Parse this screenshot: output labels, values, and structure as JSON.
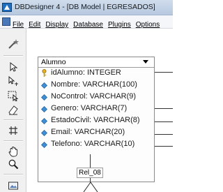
{
  "window": {
    "title": "DBDesigner 4 - [DB Model | EGRESADOS]",
    "titlebar_color": "#b7c9e0"
  },
  "menu": {
    "items": [
      "File",
      "Edit",
      "Display",
      "Database",
      "Plugins",
      "Options"
    ]
  },
  "toolbar": {
    "tools": [
      "magic-wand-icon",
      "pointer-icon",
      "move-pointer-icon",
      "select-area-icon",
      "eraser-icon",
      "grid-icon",
      "hand-icon",
      "zoom-icon",
      "image-icon"
    ]
  },
  "table": {
    "name": "Alumno",
    "columns": [
      {
        "label": "idAlumno: INTEGER",
        "icon": "key-icon"
      },
      {
        "label": "Nombre: VARCHAR(100)",
        "icon": "field-icon"
      },
      {
        "label": "NoControl: VARCHAR(9)",
        "icon": "field-icon"
      },
      {
        "label": "Genero: VARCHAR(7)",
        "icon": "field-icon"
      },
      {
        "label": "EstadoCivil: VARCHAR(8)",
        "icon": "field-icon"
      },
      {
        "label": "Email: VARCHAR(20)",
        "icon": "field-icon"
      },
      {
        "label": "Telefono: VARCHAR(10)",
        "icon": "field-icon"
      }
    ]
  },
  "relation": {
    "label": "Rel_08"
  }
}
